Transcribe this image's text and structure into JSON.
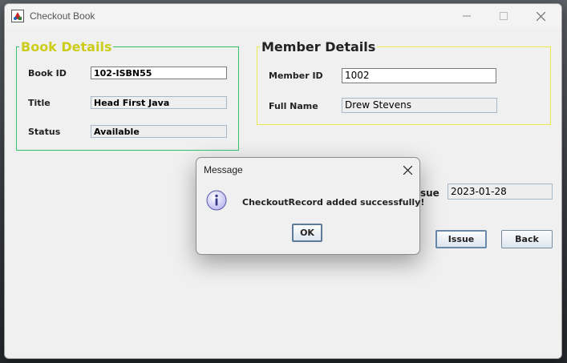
{
  "window": {
    "title": "Checkout Book"
  },
  "book_details": {
    "legend": "Book Details",
    "book_id": {
      "label": "Book ID",
      "value": "102-ISBN55"
    },
    "title": {
      "label": "Title",
      "value": "Head First Java"
    },
    "status": {
      "label": "Status",
      "value": "Available"
    }
  },
  "member_details": {
    "legend": "Member Details",
    "member_id": {
      "label": "Member ID",
      "value": "1002"
    },
    "full_name": {
      "label": "Full Name",
      "value": "Drew Stevens"
    }
  },
  "issue": {
    "label_partial": "sue",
    "date_value": "2023-01-28"
  },
  "buttons": {
    "issue": "Issue",
    "back": "Back"
  },
  "dialog": {
    "title": "Message",
    "message": "CheckoutRecord added successfully!",
    "ok": "OK",
    "icon": "info-icon"
  },
  "colors": {
    "book_legend": "#cccc1a",
    "book_border": "#35c26b",
    "member_border": "#eaea50"
  }
}
